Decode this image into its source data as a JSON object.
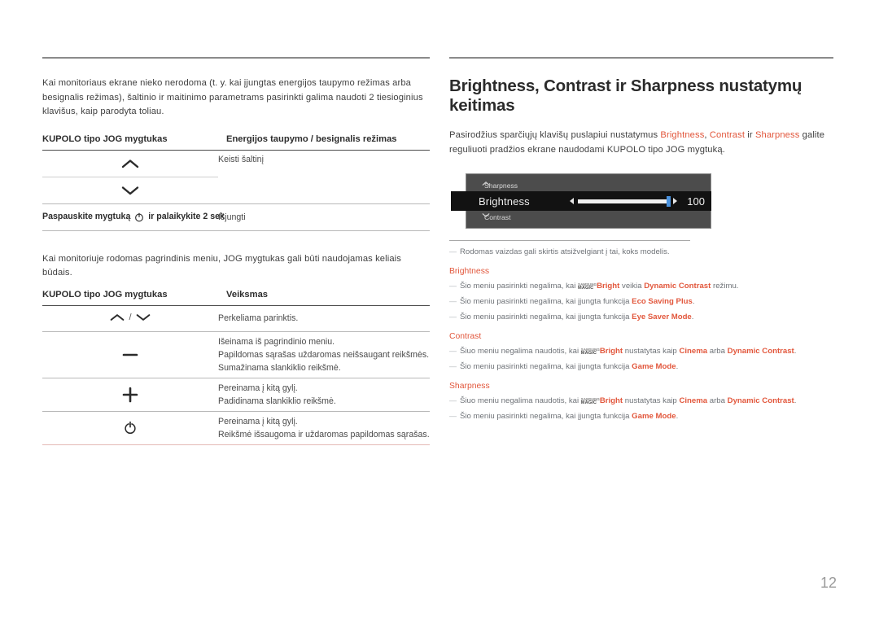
{
  "left": {
    "intro": "Kai monitoriaus ekrane nieko nerodoma (t. y. kai įjungtas energijos taupymo režimas arba besignalis režimas), šaltinio ir maitinimo parametrams pasirinkti galima naudoti 2 tiesioginius klavišus, kaip parodyta toliau.",
    "table1": {
      "col1_header": "KUPOLO tipo JOG mygtukas",
      "col2_header": "Energijos taupymo / besignalis režimas",
      "rows": [
        {
          "key_icon": "chevron-up-icon",
          "action": "Keisti šaltinį"
        },
        {
          "key_icon": "chevron-down-icon",
          "action": ""
        },
        {
          "key_text": "Paspauskite mygtuką   ir palaikykite 2 sek",
          "key_icon": "power-icon",
          "action": "Išjungti"
        }
      ]
    },
    "intro2": "Kai monitoriuje rodomas pagrindinis meniu, JOG mygtukas gali būti naudojamas keliais būdais.",
    "table2": {
      "col1_header": "KUPOLO tipo JOG mygtukas",
      "col2_header": "Veiksmas",
      "rows": [
        {
          "key_icon": "chevron-up-down-icon",
          "actions": [
            "Perkeliama parinktis."
          ]
        },
        {
          "key_icon": "minus-icon",
          "actions": [
            "Išeinama iš pagrindinio meniu.",
            "Papildomas sąrašas uždaromas neišsaugant reikšmės.",
            "Sumažinama slankiklio reikšmė."
          ]
        },
        {
          "key_icon": "plus-icon",
          "actions": [
            "Pereinama į kitą gylį.",
            "Padidinama slankiklio reikšmė."
          ]
        },
        {
          "key_icon": "power-icon",
          "actions": [
            "Pereinama į kitą gylį.",
            "Reikšmė išsaugoma ir uždaromas papildomas sąrašas."
          ]
        }
      ]
    }
  },
  "right": {
    "heading": "Brightness, Contrast ir Sharpness nustatymų keitimas",
    "intro": {
      "part1": "Pasirodžius sparčiųjų klavišų puslapiui nustatymus ",
      "a1": "Brightness",
      "sep1": ", ",
      "a2": "Contrast",
      "sep2": " ir ",
      "a3": "Sharpness",
      "part2": " galite reguliuoti pradžios ekrane naudodami KUPOLO tipo JOG mygtuką."
    },
    "osd": {
      "top_label": "Sharpness",
      "middle_label": "Brightness",
      "bottom_label": "Contrast",
      "value": "100",
      "slider_percent": 100,
      "knob_color": "#4a92de",
      "panel_bg": "#4c4c4c",
      "active_bg": "#121212"
    },
    "note_model": "Rodomas vaizdas gali skirtis atsižvelgiant į tai, koks modelis.",
    "sections": [
      {
        "title": "Brightness",
        "notes": [
          {
            "pre": "Šio meniu pasirinkti negalima, kai ",
            "logo": {
              "line1": "SAMSUNG",
              "line2": "MAGIC",
              "word": "Bright"
            },
            "mid": " veikia ",
            "strong": "Dynamic Contrast",
            "post": " režimu."
          },
          {
            "pre": "Šio meniu pasirinkti negalima, kai įjungta funkcija ",
            "strong": "Eco Saving Plus",
            "post": "."
          },
          {
            "pre": "Šio meniu pasirinkti negalima, kai įjungta funkcija ",
            "strong": "Eye Saver Mode",
            "post": "."
          }
        ]
      },
      {
        "title": "Contrast",
        "notes": [
          {
            "pre": "Šiuo meniu negalima naudotis, kai ",
            "logo": {
              "line1": "SAMSUNG",
              "line2": "MAGIC",
              "word": "Bright"
            },
            "mid": " nustatytas kaip ",
            "strong": "Cinema",
            "mid2": " arba ",
            "strong2": "Dynamic Contrast",
            "post": "."
          },
          {
            "pre": "Šio meniu pasirinkti negalima, kai įjungta funkcija ",
            "strong": "Game Mode",
            "post": "."
          }
        ]
      },
      {
        "title": "Sharpness",
        "notes": [
          {
            "pre": "Šiuo meniu negalima naudotis, kai ",
            "logo": {
              "line1": "SAMSUNG",
              "line2": "MAGIC",
              "word": "Bright"
            },
            "mid": " nustatytas kaip ",
            "strong": "Cinema",
            "mid2": " arba ",
            "strong2": "Dynamic Contrast",
            "post": "."
          },
          {
            "pre": "Šio meniu pasirinkti negalima, kai įjungta funkcija ",
            "strong": "Game Mode",
            "post": "."
          }
        ]
      }
    ]
  },
  "page_number": "12",
  "colors": {
    "accent": "#e2573c",
    "rule": "#8a8a8a",
    "text": "#3f3f3f"
  }
}
